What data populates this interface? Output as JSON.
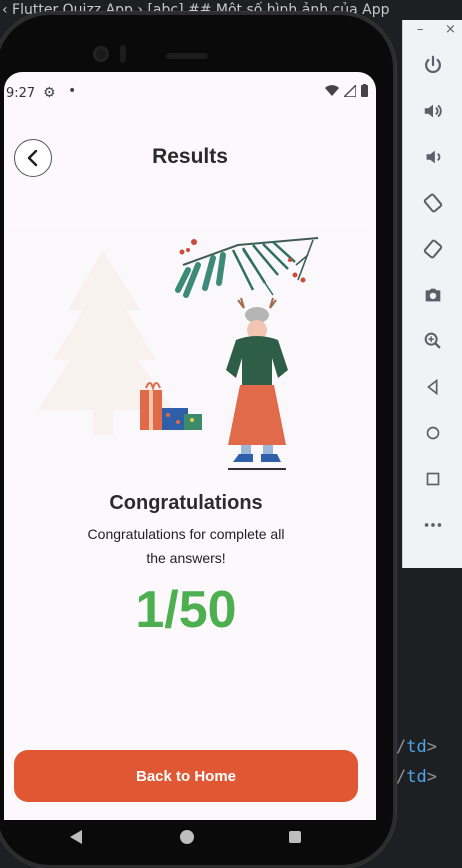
{
  "host": {
    "title_text": "‹ Flutter Quizz App › [abc] ## Một số hình ảnh của App",
    "code_lines": [
      {
        "slash": "/",
        "tag": "td",
        "bracket": ">"
      },
      {
        "slash": "/",
        "tag": "td",
        "bracket": ">"
      }
    ]
  },
  "emulator_panel": {
    "window_controls": [
      "–",
      "×"
    ],
    "buttons": [
      {
        "name": "power-icon"
      },
      {
        "name": "volume-up-icon"
      },
      {
        "name": "volume-down-icon"
      },
      {
        "name": "rotate-left-icon"
      },
      {
        "name": "rotate-right-icon"
      },
      {
        "name": "camera-icon"
      },
      {
        "name": "zoom-icon"
      },
      {
        "name": "back-icon"
      },
      {
        "name": "home-icon"
      },
      {
        "name": "overview-icon"
      },
      {
        "name": "more-icon"
      }
    ]
  },
  "status_bar": {
    "time": "9:27",
    "gear": "⚙",
    "dot": "•"
  },
  "header": {
    "title": "Results"
  },
  "result": {
    "title": "Congratulations",
    "subtitle": "Congratulations for complete all the answers!",
    "score": "1/50"
  },
  "actions": {
    "home_button": "Back to Home"
  },
  "colors": {
    "accent": "#df5733",
    "score": "#4caf50",
    "screen_bg": "#fdf8fb"
  }
}
